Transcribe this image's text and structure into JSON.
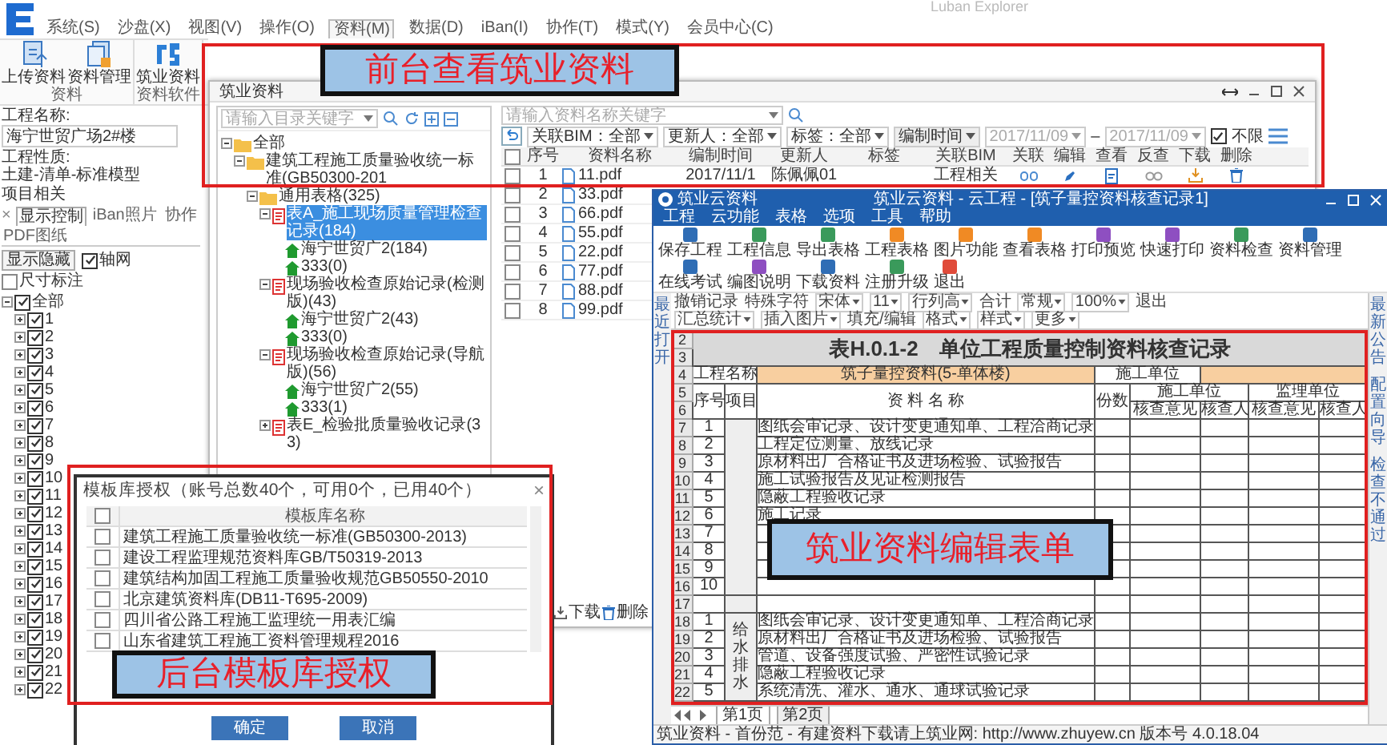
{
  "app": {
    "title": "Luban Explorer",
    "menu": [
      {
        "label": "系统(S)",
        "selected": false
      },
      {
        "label": "沙盘(X)",
        "selected": false
      },
      {
        "label": "视图(V)",
        "selected": false
      },
      {
        "label": "操作(O)",
        "selected": false
      },
      {
        "label": "资料(M)",
        "selected": true
      },
      {
        "label": "数据(D)",
        "selected": false
      },
      {
        "label": "iBan(I)",
        "selected": false
      },
      {
        "label": "协作(T)",
        "selected": false
      },
      {
        "label": "模式(Y)",
        "selected": false
      },
      {
        "label": "会员中心(C)",
        "selected": false
      }
    ],
    "ribbon": [
      {
        "label": "资料",
        "buttons": [
          {
            "label": "上传资料",
            "kind": "upload"
          },
          {
            "label": "资料管理",
            "kind": "manage"
          }
        ]
      },
      {
        "label": "资料软件",
        "buttons": [
          {
            "label": "筑业资料",
            "kind": "logo"
          }
        ]
      }
    ]
  },
  "project_panel": {
    "fields": [
      {
        "label": "工程名称:",
        "value": "海宁世贸广场2#楼",
        "kind": "input"
      },
      {
        "label": "工程性质:",
        "value": "土建-清单-标准模型",
        "kind": "text"
      }
    ],
    "section": "项目相关",
    "tabs_close": "×",
    "tabs": [
      {
        "label": "显示控制",
        "selected": true
      },
      {
        "label": "iBan照片",
        "selected": false
      },
      {
        "label": "协作",
        "selected": false
      },
      {
        "label": "PDF图纸",
        "selected": false
      }
    ],
    "show_hide_button": "显示隐藏",
    "options": [
      {
        "label": "轴网",
        "checked": true
      },
      {
        "label": "尺寸标注",
        "checked": false
      }
    ],
    "tree": [
      {
        "label": "全部",
        "checked": true,
        "expanded": true,
        "children": [
          {
            "label": "1",
            "checked": true,
            "expanded": false
          },
          {
            "label": "2",
            "checked": true,
            "expanded": false
          },
          {
            "label": "3",
            "checked": true,
            "expanded": false
          },
          {
            "label": "4",
            "checked": true,
            "expanded": false
          },
          {
            "label": "5",
            "checked": true,
            "expanded": false
          },
          {
            "label": "6",
            "checked": true,
            "expanded": false
          },
          {
            "label": "7",
            "checked": true,
            "expanded": false
          },
          {
            "label": "8",
            "checked": true,
            "expanded": false
          },
          {
            "label": "9",
            "checked": true,
            "expanded": false
          },
          {
            "label": "10",
            "checked": true,
            "expanded": false
          },
          {
            "label": "11",
            "checked": true,
            "expanded": false
          },
          {
            "label": "12",
            "checked": true,
            "expanded": false
          },
          {
            "label": "13",
            "checked": true,
            "expanded": false
          },
          {
            "label": "14",
            "checked": true,
            "expanded": false
          },
          {
            "label": "15",
            "checked": true,
            "expanded": false
          },
          {
            "label": "16",
            "checked": true,
            "expanded": false
          },
          {
            "label": "17",
            "checked": true,
            "expanded": false
          },
          {
            "label": "18",
            "checked": true,
            "expanded": false
          },
          {
            "label": "19",
            "checked": true,
            "expanded": false
          },
          {
            "label": "20",
            "checked": true,
            "expanded": false
          },
          {
            "label": "21",
            "checked": true,
            "expanded": false
          },
          {
            "label": "22",
            "checked": true,
            "expanded": false
          }
        ]
      }
    ]
  },
  "zhuye": {
    "title": "筑业资料",
    "callout": "前台查看筑业资料",
    "dir_search": {
      "placeholder": "请输入目录关键字"
    },
    "tree": [
      {
        "label": "全部",
        "kind": "folder",
        "expanded": true,
        "selected": false,
        "children": [
          {
            "label": "建筑工程施工质量验收统一标准(GB50300-201",
            "kind": "folder",
            "expanded": true,
            "selected": false,
            "children": [
              {
                "label": "通用表格(325)",
                "kind": "folder",
                "expanded": true,
                "selected": false,
                "children": [
                  {
                    "label": "表A_施工现场质量管理检查记录(184)",
                    "kind": "table",
                    "expanded": true,
                    "selected": true,
                    "children": [
                      {
                        "label": "海宁世贸广2(184)",
                        "kind": "project",
                        "selected": false
                      },
                      {
                        "label": "333(0)",
                        "kind": "project",
                        "selected": false
                      }
                    ]
                  },
                  {
                    "label": "现场验收检查原始记录(检测版)(43)",
                    "kind": "table",
                    "expanded": true,
                    "selected": false,
                    "children": [
                      {
                        "label": "海宁世贸广2(43)",
                        "kind": "project",
                        "selected": false
                      },
                      {
                        "label": "333(0)",
                        "kind": "project",
                        "selected": false
                      }
                    ]
                  },
                  {
                    "label": "现场验收检查原始记录(导航版)(56)",
                    "kind": "table",
                    "expanded": true,
                    "selected": false,
                    "children": [
                      {
                        "label": "海宁世贸广2(55)",
                        "kind": "project",
                        "selected": false
                      },
                      {
                        "label": "333(1)",
                        "kind": "project",
                        "selected": false
                      }
                    ]
                  },
                  {
                    "label": "表E_检验批质量验收记录(33)",
                    "kind": "table",
                    "expanded": false,
                    "selected": false
                  }
                ]
              }
            ]
          }
        ]
      }
    ],
    "file_search": {
      "placeholder": "请输入资料名称关键字"
    },
    "filters": [
      "关联BIM：全部",
      "更新人：全部",
      "标签：全部",
      "编制时间"
    ],
    "date_from": "2017/11/09",
    "date_sep": "–",
    "date_to": "2017/11/09",
    "unlimited": {
      "label": "不限",
      "checked": true
    },
    "header_checked": false,
    "columns": [
      "序号",
      "资料名称",
      "编制时间",
      "更新人",
      "标签",
      "关联BIM",
      "关联",
      "编辑",
      "查看",
      "反查",
      "下载",
      "删除"
    ],
    "rows": [
      {
        "checked": false,
        "no": "1",
        "name": "11.pdf",
        "date": "2017/11/1",
        "user": "陈佩佩01",
        "bim": "工程相关"
      },
      {
        "checked": false,
        "no": "2",
        "name": "33.pdf"
      },
      {
        "checked": false,
        "no": "3",
        "name": "66.pdf"
      },
      {
        "checked": false,
        "no": "4",
        "name": "55.pdf"
      },
      {
        "checked": false,
        "no": "5",
        "name": "22.pdf"
      },
      {
        "checked": false,
        "no": "6",
        "name": "77.pdf"
      },
      {
        "checked": false,
        "no": "7",
        "name": "88.pdf"
      },
      {
        "checked": false,
        "no": "8",
        "name": "99.pdf"
      }
    ],
    "footer": [
      {
        "label": "下载",
        "kind": "download"
      },
      {
        "label": "删除",
        "kind": "delete"
      }
    ]
  },
  "dialog": {
    "title": "模板库授权（账号总数40个，可用0个，已用40个）",
    "close": "×",
    "callout": "后台模板库授权",
    "header_checked": false,
    "column": "模板库名称",
    "rows": [
      {
        "name": "建筑工程施工质量验收统一标准(GB50300-2013)",
        "checked": false
      },
      {
        "name": "建设工程监理规范资料库GB/T50319-2013",
        "checked": false
      },
      {
        "name": "建筑结构加固工程施工质量验收规范GB50550-2010",
        "checked": false
      },
      {
        "name": "北京建筑资料库(DB11-T695-2009)",
        "checked": false
      },
      {
        "name": "四川省公路工程施工监理统一用表汇编",
        "checked": false
      },
      {
        "name": "山东省建筑工程施工资料管理规程2016",
        "checked": false
      }
    ],
    "buttons": [
      "确定",
      "取消"
    ]
  },
  "editor": {
    "app_name": "筑业云资料",
    "title": "筑业云资料 - 云工程 - [筑子量控资料核查记录1]",
    "callout": "筑业资料编辑表单",
    "menu": [
      "工程",
      "云功能",
      "表格",
      "选项",
      "工具",
      "帮助"
    ],
    "toolbar": [
      {
        "label": "保存工程",
        "color": "#2f6db5"
      },
      {
        "label": "工程信息",
        "color": "#3a9a5b"
      },
      {
        "label": "导出表格",
        "color": "#3a9a5b"
      },
      {
        "label": "工程表格",
        "color": "#f08a24"
      },
      {
        "label": "图片功能",
        "color": "#f08a24"
      },
      {
        "label": "查看表格",
        "color": "#f08a24"
      },
      {
        "label": "打印预览",
        "color": "#8e4fc1"
      },
      {
        "label": "快速打印",
        "color": "#8e4fc1"
      },
      {
        "label": "资料检查",
        "color": "#3a9a5b"
      },
      {
        "label": "资料管理",
        "color": "#2f6db5"
      },
      {
        "label": "在线考试",
        "color": "#2f6db5"
      },
      {
        "label": "编图说明",
        "color": "#8e4fc1"
      },
      {
        "label": "下载资料",
        "color": "#2f6db5"
      },
      {
        "label": "注册升级",
        "color": "#3a9a5b"
      },
      {
        "label": "退出",
        "color": "#e04b3a"
      }
    ],
    "format_bar": [
      [
        {
          "label": "撤销记录",
          "kind": "button"
        },
        {
          "label": "特殊字符",
          "kind": "button"
        },
        {
          "label": "宋体",
          "kind": "dropdown"
        },
        {
          "label": "11",
          "kind": "dropdown"
        },
        {
          "label": "行列高",
          "kind": "dropdown"
        },
        {
          "label": "合计",
          "kind": "button"
        },
        {
          "label": "常规",
          "kind": "dropdown"
        },
        {
          "label": "100%",
          "kind": "dropdown"
        },
        {
          "label": "退出",
          "kind": "button"
        }
      ],
      [
        {
          "label": "汇总统计",
          "kind": "dropdown"
        },
        {
          "label": "插入图片",
          "kind": "dropdown"
        },
        {
          "label": "填充/编辑",
          "kind": "button"
        },
        {
          "label": "格式",
          "kind": "dropdown"
        },
        {
          "label": "样式",
          "kind": "dropdown"
        },
        {
          "label": "更多",
          "kind": "dropdown"
        }
      ]
    ],
    "left_tab": "最近打开",
    "right_tabs": [
      "最新公告",
      "配置向导",
      "检查不通过"
    ],
    "sheet": {
      "title_rows": [
        "2",
        "3"
      ],
      "title": "表H.0.1-2　单位工程质量控制资料核查记录",
      "project_row": {
        "row": "4",
        "label": "工程名称",
        "value": "筑子量控资料(5-单体楼)",
        "unit_label": "施工单位"
      },
      "header_rows": [
        "5",
        "6"
      ],
      "headers": {
        "no": "序号",
        "item": "项目",
        "name": "资 料 名 称",
        "count": "份数",
        "unit1": "施工单位",
        "unit2": "监理单位",
        "sub": [
          "核查意见",
          "核查人",
          "核查意见",
          "核查人"
        ]
      },
      "sections": [
        {
          "items": [
            {
              "row": "7",
              "no": "1",
              "name": "图纸会审记录、设计变更通知单、工程洽商记录"
            },
            {
              "row": "8",
              "no": "2",
              "name": "工程定位测量、放线记录"
            },
            {
              "row": "9",
              "no": "3",
              "name": "原材料出厂合格证书及进场检验、试验报告"
            },
            {
              "row": "10",
              "no": "4",
              "name": "施工试验报告及见证检测报告"
            },
            {
              "row": "11",
              "no": "5",
              "name": "隐蔽工程验收记录"
            },
            {
              "row": "12",
              "no": "6",
              "name": "施工记录"
            },
            {
              "row": "13",
              "no": "7"
            },
            {
              "row": "14",
              "no": "8"
            },
            {
              "row": "15",
              "no": "9"
            },
            {
              "row": "16",
              "no": "10"
            }
          ]
        },
        {
          "items": [
            {
              "row": "17"
            }
          ]
        },
        {
          "label": "给水排水",
          "items": [
            {
              "row": "18",
              "no": "1",
              "name": "图纸会审记录、设计变更通知单、工程洽商记录"
            },
            {
              "row": "19",
              "no": "2",
              "name": "原材料出厂合格证书及进场检验、试验报告"
            },
            {
              "row": "20",
              "no": "3",
              "name": "管道、设备强度试验、严密性试验记录"
            },
            {
              "row": "21",
              "no": "4",
              "name": "隐蔽工程验收记录"
            },
            {
              "row": "22",
              "no": "5",
              "name": "系统清洗、灌水、通水、通球试验记录"
            }
          ]
        }
      ]
    },
    "sheet_tabs": [
      {
        "label": "第1页",
        "selected": true
      },
      {
        "label": "第2页",
        "selected": false
      }
    ],
    "status": "筑业资料 - 首份范 - 有建资料下载请上筑业网: http://www.zhuyew.cn 版本号 4.0.18.04"
  }
}
